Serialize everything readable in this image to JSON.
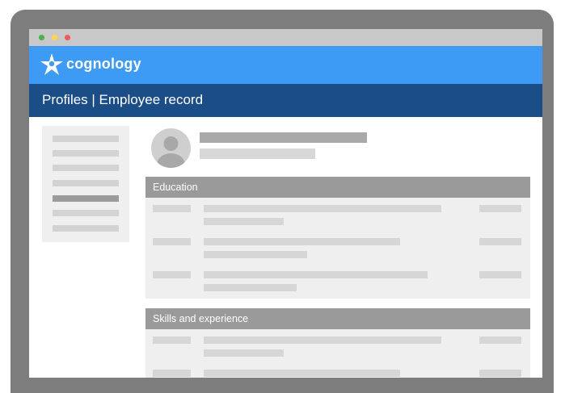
{
  "window": {
    "traffic_lights": [
      "#4caf50",
      "#ffd54f",
      "#f05a5a"
    ]
  },
  "colors": {
    "device_frame": "#7d7d7d",
    "app_bar": "#3d9bf5",
    "header_bar": "#1b4e86",
    "section_header": "#9a9a9a",
    "panel_bg": "#efefef"
  },
  "app": {
    "brand": "cognology",
    "logo_icon": "cognology-star-logo"
  },
  "header": {
    "title": "Profiles | Employee record"
  },
  "profile": {
    "avatar_icon": "user-avatar-icon"
  },
  "sections": [
    {
      "title": "Education"
    },
    {
      "title": "Skills and experience"
    }
  ]
}
